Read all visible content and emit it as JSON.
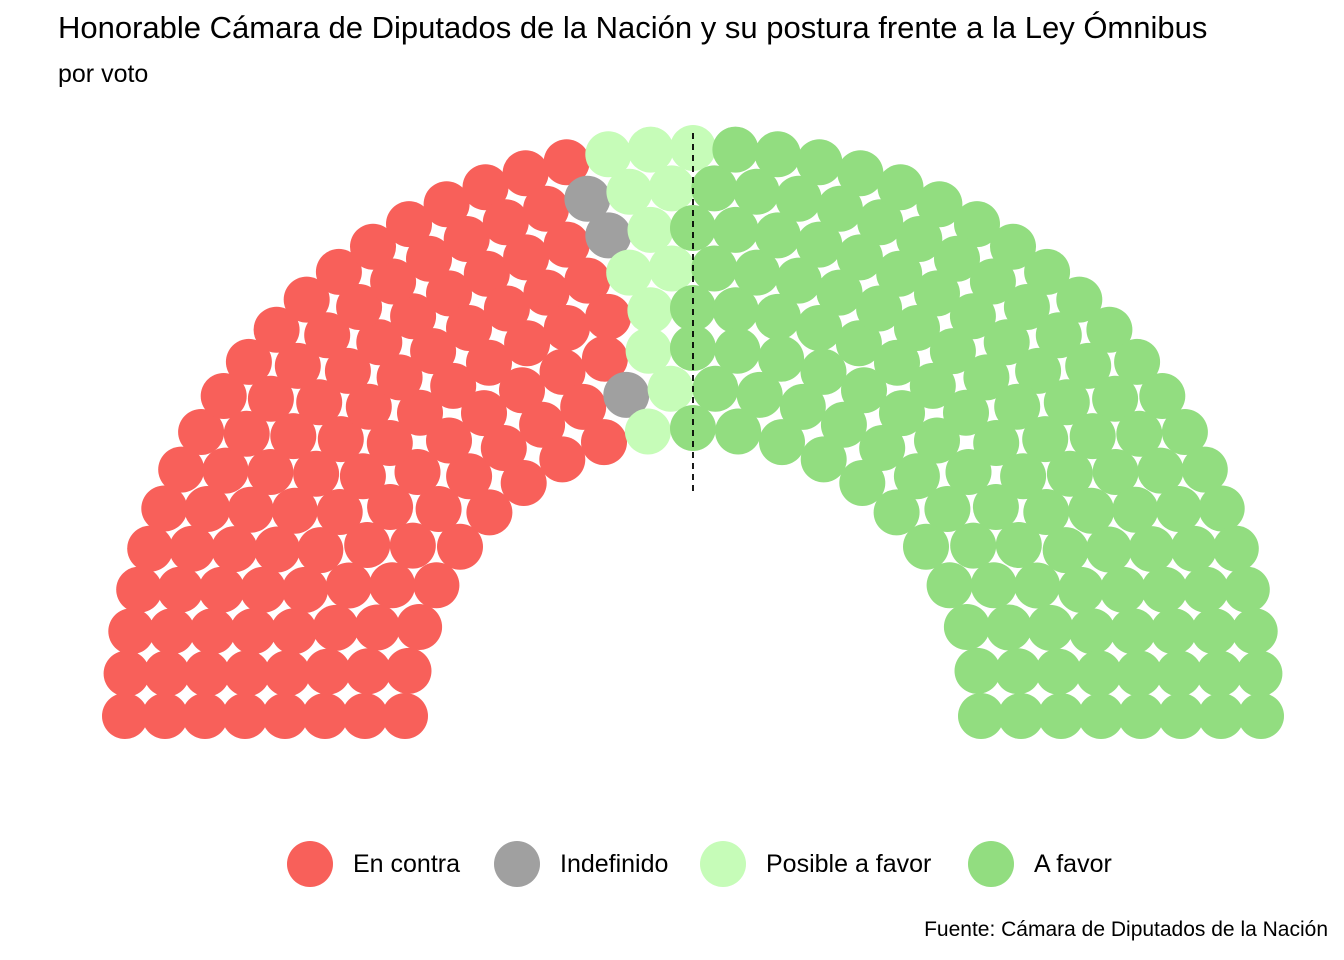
{
  "chart_data": {
    "type": "parliament",
    "title": "Honorable Cámara de Diputados de la Nación y su postura frente a la Ley Ómnibus",
    "subtitle": "por voto",
    "caption": "Fuente: Cámara de Diputados de la Nación",
    "series": [
      {
        "name": "En contra",
        "seats": 112,
        "color": "#f8605a"
      },
      {
        "name": "Indefinido",
        "seats": 3,
        "color": "#a0a0a0"
      },
      {
        "name": "Posible a favor",
        "seats": 12,
        "color": "#c6fcb8"
      },
      {
        "name": "A favor",
        "seats": 130,
        "color": "#92dd80"
      }
    ],
    "total_seats": 257,
    "rows": 8,
    "majority_line": true,
    "legend_position": "bottom"
  }
}
